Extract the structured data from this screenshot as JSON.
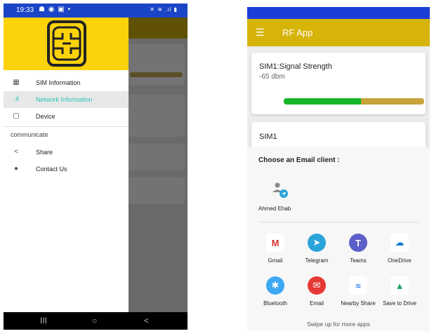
{
  "left_phone": {
    "status": {
      "time": "19:33"
    },
    "drawer": {
      "items": [
        {
          "label": "SIM Information",
          "icon": "sim-card-icon",
          "active": false
        },
        {
          "label": "Network Information",
          "icon": "signal-bars-icon",
          "active": true
        },
        {
          "label": "Device",
          "icon": "device-icon",
          "active": false
        }
      ],
      "section_title": "communicate",
      "section_items": [
        {
          "label": "Share",
          "icon": "share-icon"
        },
        {
          "label": "Contact Us",
          "icon": "help-icon"
        }
      ]
    },
    "nav": {
      "recents": "III",
      "home": "○",
      "back": "<"
    }
  },
  "right_phone": {
    "toolbar": {
      "title": "RF App",
      "menu_icon": "☰"
    },
    "signal_card": {
      "title": "SIM1:Signal Strength",
      "value": "-65 dbm",
      "strength_fraction": 0.55
    },
    "sim_card": {
      "title": "SIM1"
    },
    "share_sheet": {
      "title": "Choose an Email client :",
      "contact": {
        "name": "Ahmed Ehab"
      },
      "apps": [
        {
          "label": "Gmail",
          "icon": "gmail-icon",
          "glyph": "M",
          "color": "#ffffff",
          "fg": "#d93025"
        },
        {
          "label": "Telegram",
          "icon": "telegram-icon",
          "glyph": "➤",
          "color": "#2aa4d9",
          "fg": "#ffffff"
        },
        {
          "label": "Teams",
          "icon": "teams-icon",
          "glyph": "T",
          "color": "#5b5fc7",
          "fg": "#ffffff"
        },
        {
          "label": "OneDrive",
          "icon": "onedrive-icon",
          "glyph": "☁",
          "color": "#ffffff",
          "fg": "#0f78d4"
        },
        {
          "label": "Bluetooth",
          "icon": "bluetooth-icon",
          "glyph": "✱",
          "color": "#3ea7f2",
          "fg": "#ffffff"
        },
        {
          "label": "Email",
          "icon": "email-icon",
          "glyph": "✉",
          "color": "#e53935",
          "fg": "#ffffff"
        },
        {
          "label": "Nearby Share",
          "icon": "nearby-share-icon",
          "glyph": "≈",
          "color": "#ffffff",
          "fg": "#1a73e8"
        },
        {
          "label": "Save to Drive",
          "icon": "google-drive-icon",
          "glyph": "▲",
          "color": "#ffffff",
          "fg": "#1fa463"
        }
      ],
      "footer": "Swipe up for more apps"
    }
  }
}
